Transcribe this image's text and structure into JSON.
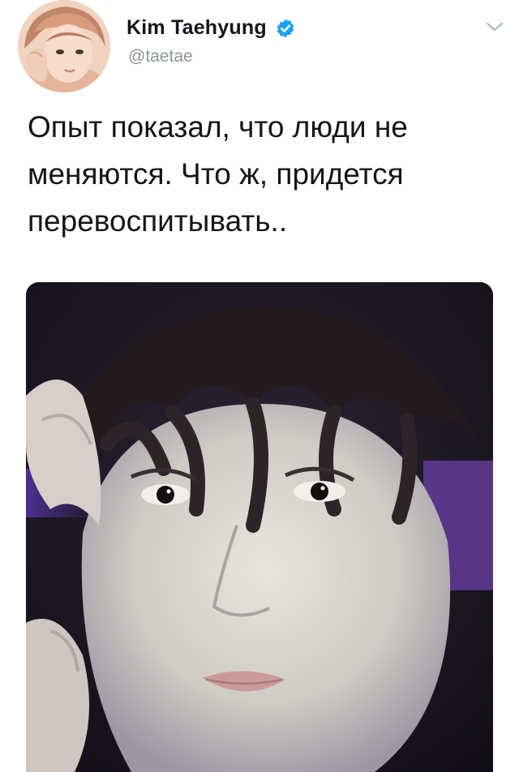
{
  "tweet": {
    "author": {
      "display_name": "Kim Taehyung",
      "handle": "@taetae",
      "verified": true,
      "verified_icon": "verified-badge-icon",
      "verified_color": "#1da1f2"
    },
    "menu_icon": "chevron-down-icon",
    "text": "Опыт показал, что люди не\nменяются. Что ж, придется\nперевоспитывать..",
    "media": {
      "type": "photo"
    }
  },
  "colors": {
    "text": "#14171a",
    "muted": "#8a959e",
    "background": "#ffffff"
  }
}
